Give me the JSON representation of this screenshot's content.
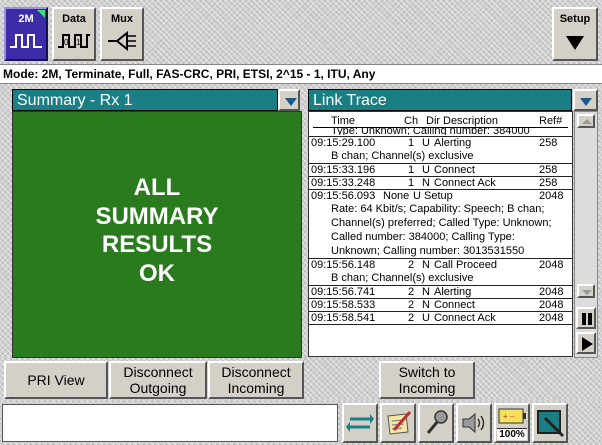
{
  "toolbar": {
    "tab_2m": "2M",
    "tab_data": "Data",
    "tab_mux": "Mux",
    "setup": "Setup"
  },
  "mode_line": "Mode: 2M, Terminate, Full, FAS-CRC, PRI, ETSI, 2^15 - 1, ITU, Any",
  "summary": {
    "header": "Summary - Rx 1",
    "lines": [
      "ALL",
      "SUMMARY",
      "RESULTS",
      "OK"
    ]
  },
  "trace": {
    "header": "Link Trace",
    "columns": {
      "time": "Time",
      "ch": "Ch",
      "dir": "Dir",
      "desc": "Description",
      "ref": "Ref#"
    },
    "partial_line": "Type: Unknown; Calling number: 384000",
    "rows": [
      {
        "time": "09:15:29.100",
        "ch": "1",
        "dir": "U",
        "desc": "Alerting",
        "ref": "258",
        "detail": "B chan; Channel(s) exclusive"
      },
      {
        "time": "09:15:33.196",
        "ch": "1",
        "dir": "U",
        "desc": "Connect",
        "ref": "258",
        "detail": ""
      },
      {
        "time": "09:15:33.248",
        "ch": "1",
        "dir": "N",
        "desc": "Connect Ack",
        "ref": "258",
        "detail": ""
      },
      {
        "time": "09:15:56.093",
        "ch": "None",
        "dir": "U",
        "desc": "Setup",
        "ref": "2048",
        "detail": "Rate: 64 Kbit/s; Capability: Speech; B chan; Channel(s) preferred; Called Type: Unknown; Called number: 384000; Calling Type: Unknown; Calling number: 3013531550"
      },
      {
        "time": "09:15:56.148",
        "ch": "2",
        "dir": "N",
        "desc": "Call Proceed",
        "ref": "2048",
        "detail": "B chan; Channel(s) exclusive"
      },
      {
        "time": "09:15:56.741",
        "ch": "2",
        "dir": "N",
        "desc": "Alerting",
        "ref": "2048",
        "detail": ""
      },
      {
        "time": "09:15:58.533",
        "ch": "2",
        "dir": "N",
        "desc": "Connect",
        "ref": "2048",
        "detail": ""
      },
      {
        "time": "09:15:58.541",
        "ch": "2",
        "dir": "U",
        "desc": "Connect Ack",
        "ref": "2048",
        "detail": ""
      }
    ]
  },
  "bottom_buttons": {
    "pri_view": "PRI View",
    "disc_out_1": "Disconnect",
    "disc_out_2": "Outgoing",
    "disc_in_1": "Disconnect",
    "disc_in_2": "Incoming",
    "switch_1": "Switch to",
    "switch_2": "Incoming"
  },
  "status_icons": {
    "battery_level": "100%"
  },
  "colors": {
    "summary_ok_bg": "#2a7a1e",
    "header_teal": "#1a7f84",
    "active_tab": "#3c2ca8"
  }
}
